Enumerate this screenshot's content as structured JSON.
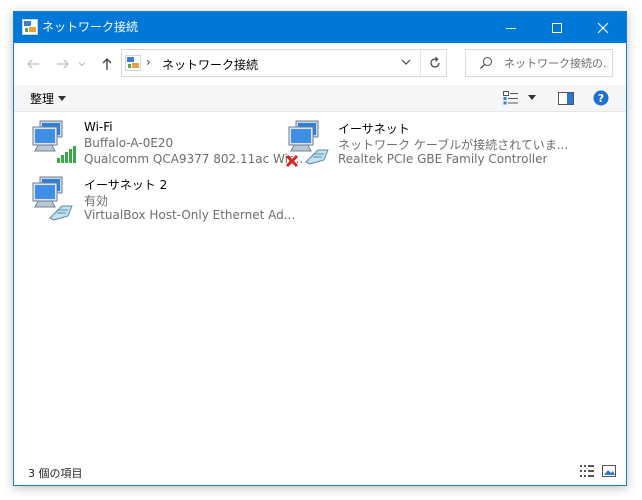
{
  "window": {
    "title": "ネットワーク接続"
  },
  "address": {
    "path": "ネットワーク接続",
    "separator": "›"
  },
  "search": {
    "placeholder": "ネットワーク接続の..."
  },
  "toolbar": {
    "organize_label": "整理"
  },
  "items": [
    {
      "name": "Wi-Fi",
      "line2": "Buffalo-A-0E20",
      "line3": "Qualcomm QCA9377 802.11ac Wir...",
      "type": "wifi"
    },
    {
      "name": "イーサネット",
      "line2": "ネットワーク ケーブルが接続されていま...",
      "line3": "Realtek PCIe GBE Family Controller",
      "type": "ethernet-disconnected"
    },
    {
      "name": "イーサネット 2",
      "line2": "有効",
      "line3": "VirtualBox Host-Only Ethernet Ad...",
      "type": "ethernet"
    }
  ],
  "status": {
    "count": "3 個の項目"
  },
  "colors": {
    "titlebar": "#0078d7",
    "help": "#1e6fd0",
    "signal": "#3aa84a",
    "error": "#d9231d"
  }
}
